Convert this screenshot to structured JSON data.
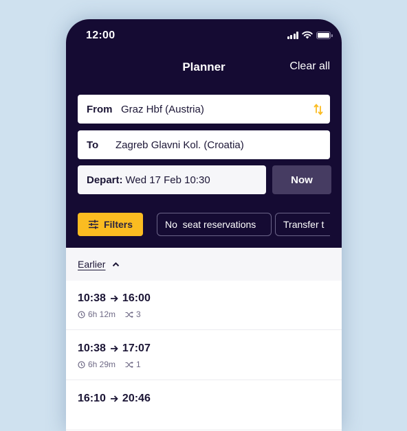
{
  "status_bar": {
    "time": "12:00",
    "icons": [
      "cellular-signal-icon",
      "wifi-icon",
      "battery-icon"
    ]
  },
  "header": {
    "title": "Planner",
    "clear_all_label": "Clear all"
  },
  "search": {
    "from_label": "From",
    "from_value": "Graz Hbf (Austria)",
    "to_label": "To",
    "to_value": "Zagreb Glavni Kol. (Croatia)",
    "swap_icon": "swap-vertical-icon",
    "depart_label": "Depart:",
    "depart_value": "Wed 17 Feb 10:30",
    "now_label": "Now"
  },
  "filters": {
    "filters_label": "Filters",
    "filters_icon": "sliders-icon",
    "chips": [
      {
        "label": "No  seat reservations"
      },
      {
        "label": "Transfer t"
      }
    ]
  },
  "results": {
    "earlier_label": "Earlier",
    "journeys": [
      {
        "depart": "10:38",
        "arrive": "16:00",
        "duration": "6h 12m",
        "transfers": "3"
      },
      {
        "depart": "10:38",
        "arrive": "17:07",
        "duration": "6h 29m",
        "transfers": "1"
      },
      {
        "depart": "16:10",
        "arrive": "20:46",
        "duration": "",
        "transfers": ""
      }
    ]
  },
  "colors": {
    "header_bg": "#150b33",
    "accent_yellow": "#fbbc21",
    "now_button_bg": "#463c62",
    "page_bg": "#cfe1ef"
  }
}
